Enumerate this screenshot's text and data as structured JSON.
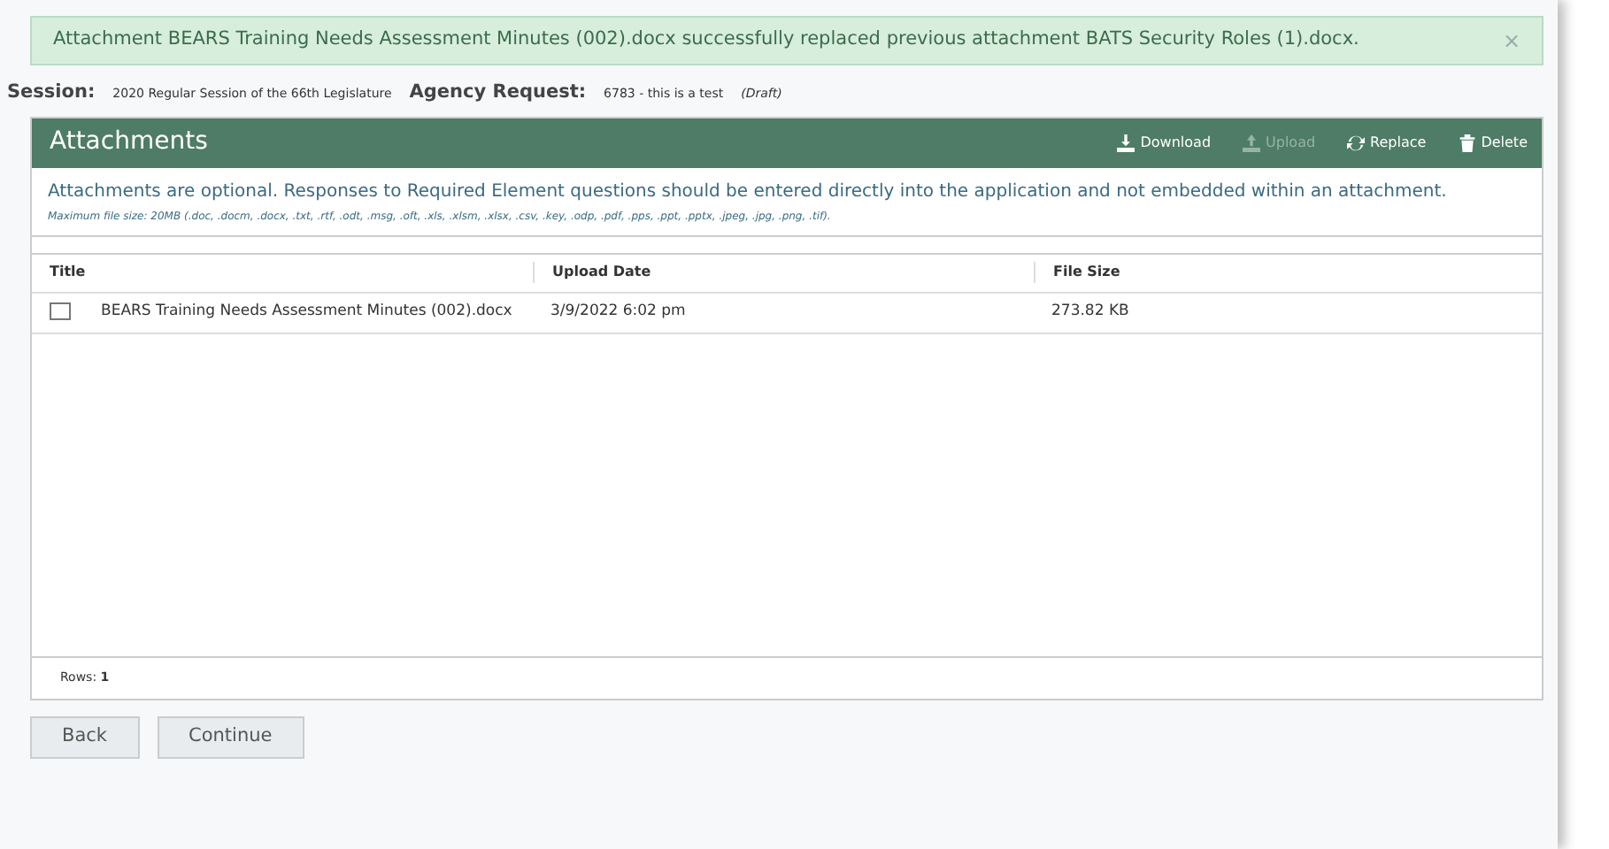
{
  "alert": {
    "message": "Attachment BEARS Training Needs Assessment Minutes (002).docx successfully replaced previous attachment BATS Security Roles (1).docx.",
    "close": "×"
  },
  "context": [
    {
      "label": "Session:",
      "value": "2020 Regular Session of the 66th Legislature"
    },
    {
      "label": "Agency Request:",
      "value": "6783 - this is a test",
      "status": "(Draft)"
    }
  ],
  "panel": {
    "title": "Attachments",
    "actions": [
      {
        "kind": "download",
        "label": "Download",
        "disabled": false
      },
      {
        "kind": "upload",
        "label": "Upload",
        "disabled": true
      },
      {
        "kind": "replace",
        "label": "Replace",
        "disabled": false
      },
      {
        "kind": "delete",
        "label": "Delete",
        "disabled": false
      }
    ],
    "note": "Attachments are optional. Responses to Required Element questions should be entered directly into the application and not embedded within an attachment.",
    "file_types": "Maximum file size: 20MB (.doc, .docm, .docx, .txt, .rtf, .odt, .msg, .oft, .xls, .xlsm, .xlsx, .csv, .key, .odp, .pdf, .pps, .ppt, .pptx, .jpeg, .jpg, .png, .tif)."
  },
  "table": {
    "columns": [
      "Title",
      "Upload Date",
      "File Size"
    ],
    "rows": [
      {
        "checked": false,
        "cells": [
          "BEARS Training Needs Assessment Minutes (002).docx",
          "3/9/2022 6:02 pm",
          "273.82 KB"
        ]
      }
    ],
    "footer": "Rows: **1**"
  },
  "buttons": [
    "Back",
    "Continue"
  ]
}
